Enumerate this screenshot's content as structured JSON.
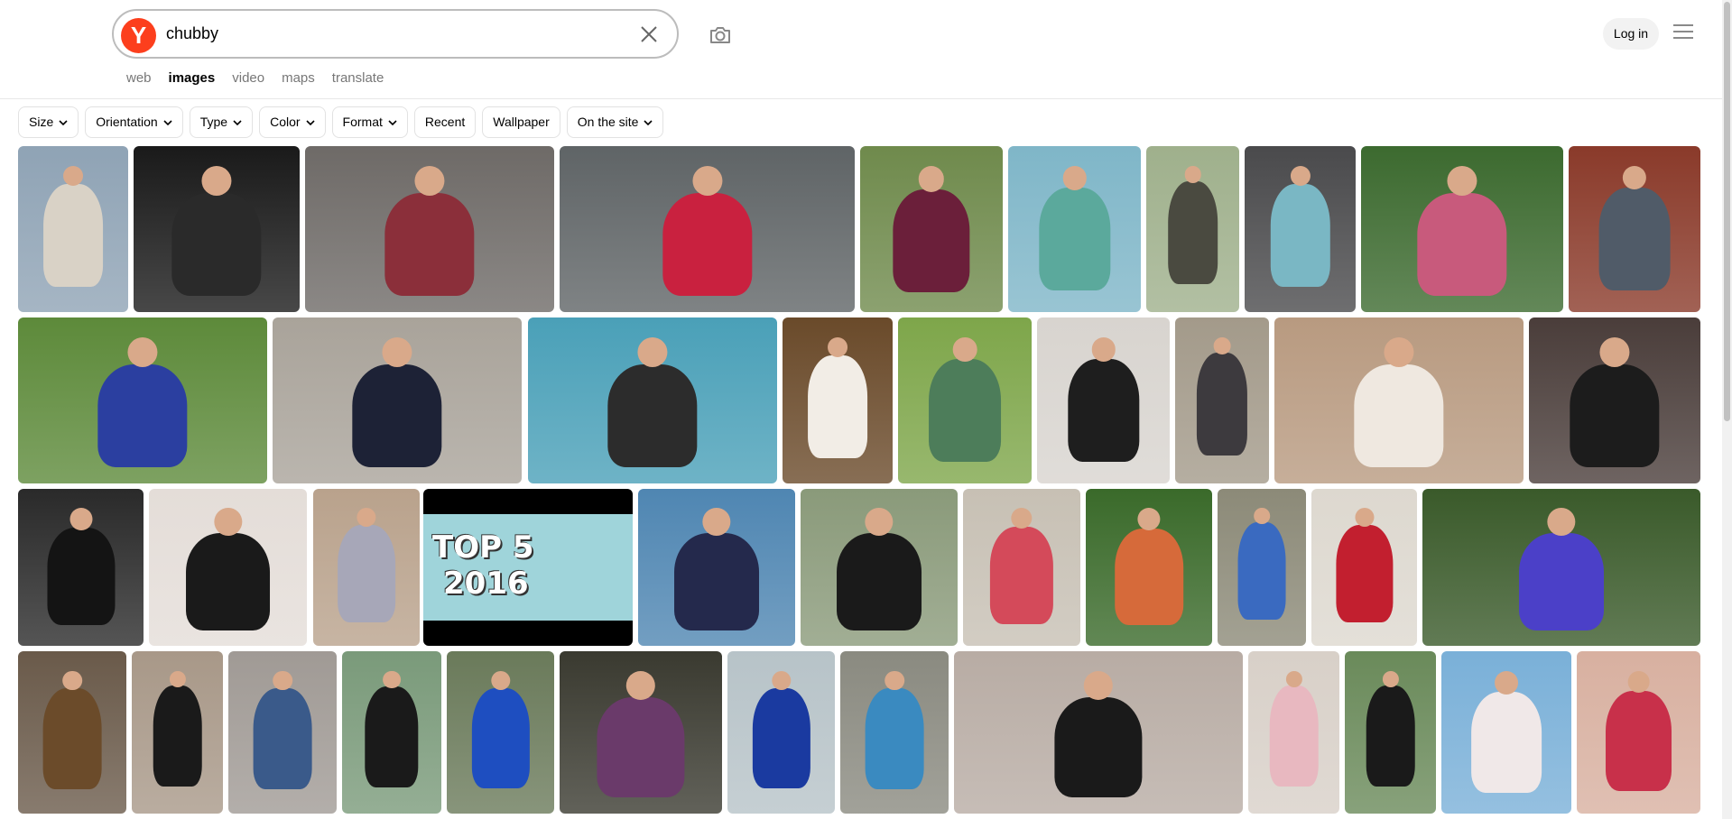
{
  "search": {
    "query": "chubby",
    "logo_letter": "Y"
  },
  "header": {
    "login_label": "Log in"
  },
  "tabs": [
    {
      "label": "web",
      "active": false
    },
    {
      "label": "images",
      "active": true
    },
    {
      "label": "video",
      "active": false
    },
    {
      "label": "maps",
      "active": false
    },
    {
      "label": "translate",
      "active": false
    }
  ],
  "filters": [
    {
      "label": "Size",
      "dropdown": true
    },
    {
      "label": "Orientation",
      "dropdown": true
    },
    {
      "label": "Type",
      "dropdown": true
    },
    {
      "label": "Color",
      "dropdown": true
    },
    {
      "label": "Format",
      "dropdown": true
    },
    {
      "label": "Recent",
      "dropdown": false
    },
    {
      "label": "Wallpaper",
      "dropdown": false
    },
    {
      "label": "On the site",
      "dropdown": true
    }
  ],
  "thumbnail_overlay_text": [
    "TOP 5",
    "2016"
  ],
  "colors": {
    "brand": "#fc3f1d",
    "accent_tab": "#000000",
    "muted_tab": "#777777"
  },
  "icons": [
    "yandex-logo",
    "clear-icon",
    "camera-search-icon",
    "hamburger-menu-icon",
    "chevron-down-icon"
  ]
}
